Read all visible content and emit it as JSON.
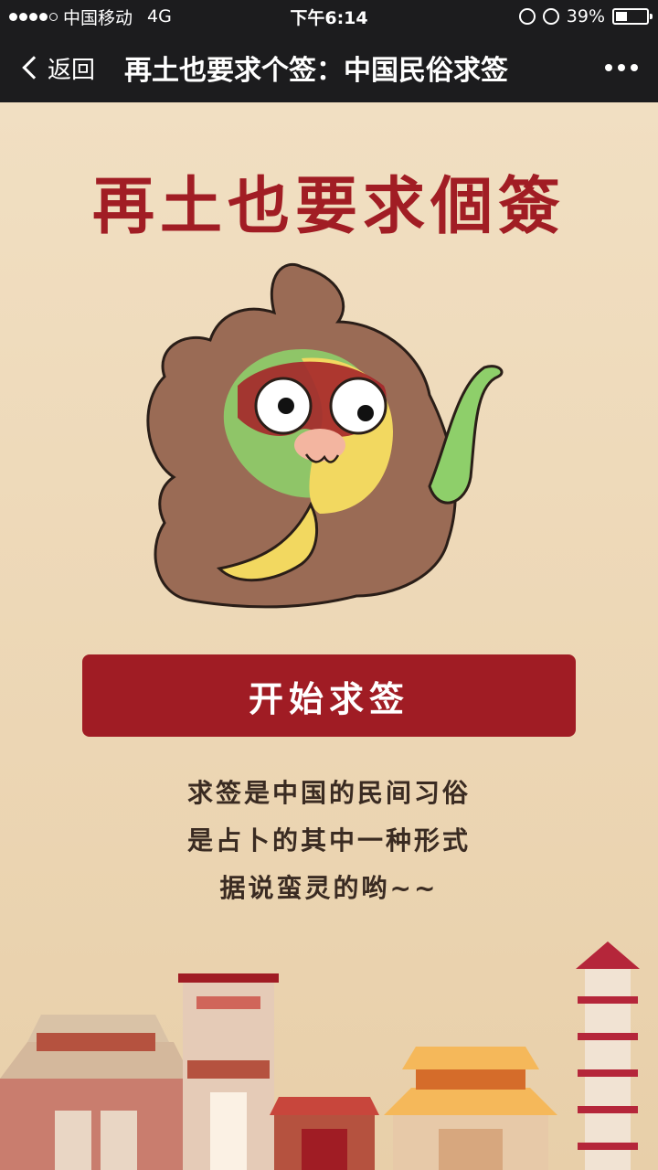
{
  "status": {
    "carrier": "中国移动",
    "network": "4G",
    "time": "下午6:14",
    "battery_text": "39%",
    "battery_level": 0.39
  },
  "nav": {
    "back_label": "返回",
    "title": "再土也要求个签：中国民俗求签"
  },
  "main": {
    "headline": "再土也要求個簽",
    "button_label": "开始求签",
    "description": [
      "求签是中国的民间习俗",
      "是占卜的其中一种形式",
      "据说蛮灵的哟~~"
    ]
  },
  "colors": {
    "accent": "#a01c24",
    "background": "#efdcbf",
    "bar": "#1c1c1e"
  }
}
